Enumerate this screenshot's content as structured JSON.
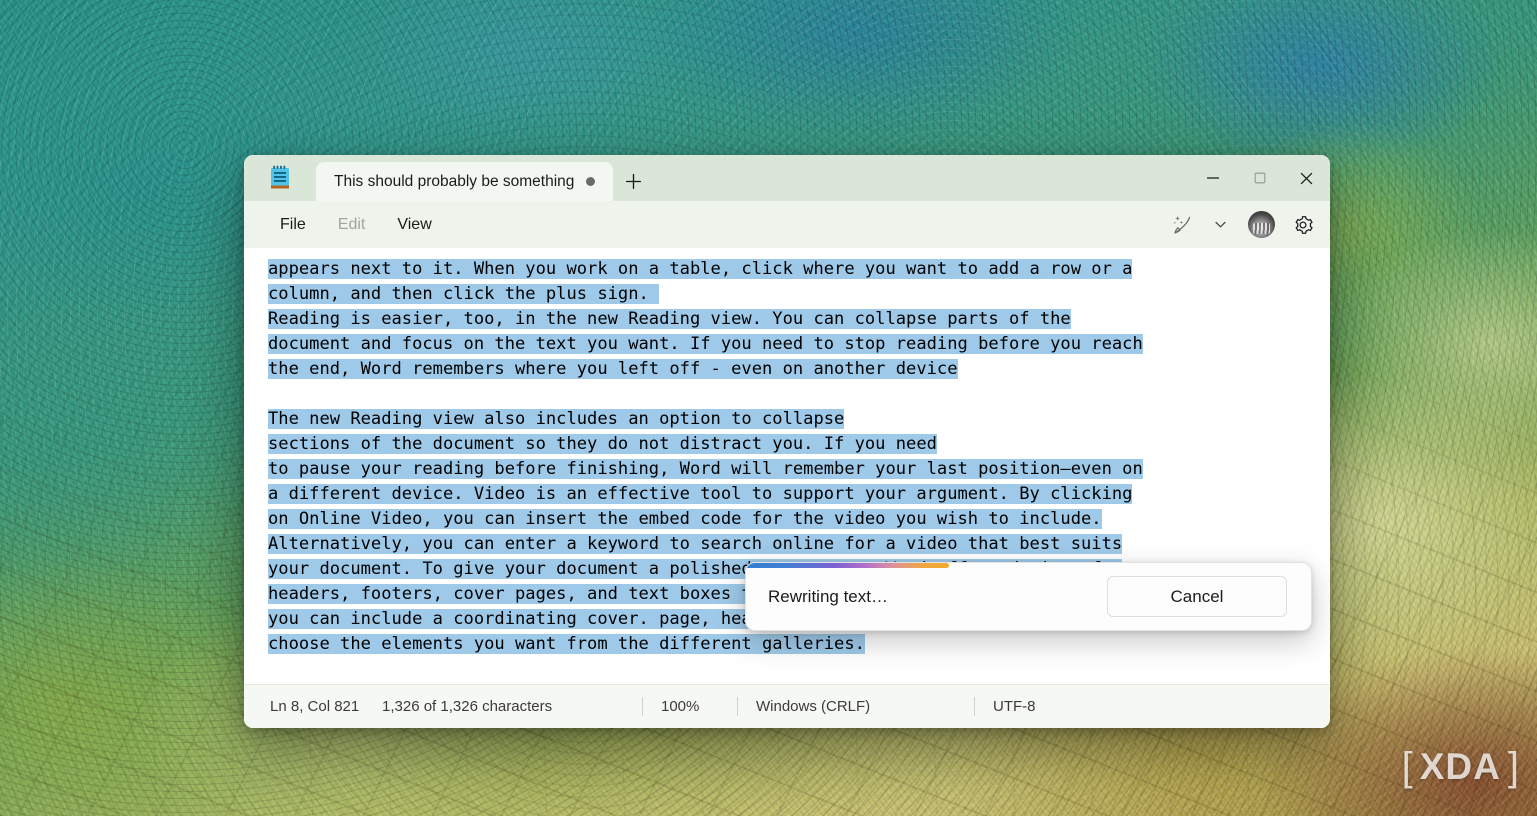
{
  "desktop": {
    "watermark": {
      "left_bracket": "[",
      "text": "XDA",
      "right_bracket": "]"
    }
  },
  "window": {
    "app_icon": "notepad-icon",
    "tab": {
      "title": "This should probably be something",
      "unsaved_dot": "●"
    },
    "new_tab_label": "+",
    "controls": {
      "minimize": "minimize-icon",
      "maximize": "maximize-icon",
      "close": "close-icon"
    }
  },
  "menu": {
    "items": [
      {
        "label": "File",
        "disabled": false
      },
      {
        "label": "Edit",
        "disabled": true
      },
      {
        "label": "View",
        "disabled": false
      }
    ],
    "right_icons": [
      {
        "name": "ai-rewrite-icon"
      },
      {
        "name": "chevron-down-icon"
      },
      {
        "name": "account-avatar"
      },
      {
        "name": "settings-gear-icon"
      }
    ]
  },
  "editor": {
    "lines": [
      {
        "text": "appears next to it. When you work on a table, click where you want to add a row or a",
        "selected": true
      },
      {
        "text": "column, and then click the plus sign. ",
        "selected": true
      },
      {
        "text": "Reading is easier, too, in the new Reading view. You can collapse parts of the",
        "selected": true
      },
      {
        "text": "document and focus on the text you want. If you need to stop reading before you reach",
        "selected": true
      },
      {
        "text": "the end, Word remembers where you left off - even on another device",
        "selected": true
      },
      {
        "text": "",
        "selected": false
      },
      {
        "text": "The new Reading view also includes an option to collapse",
        "selected": true
      },
      {
        "text": "sections of the document so they do not distract you. If you need",
        "selected": true
      },
      {
        "text": "to pause your reading before finishing, Word will remember your last position—even on",
        "selected": true
      },
      {
        "text": "a different device. Video is an effective tool to support your argument. By clicking",
        "selected": true
      },
      {
        "text": "on Online Video, you can insert the embed code for the video you wish to include.",
        "selected": true
      },
      {
        "text": "Alternatively, you can enter a keyword to search online for a video that best suits",
        "selected": true
      },
      {
        "text": "your document. To give your document a polished appearance, Word offers designs for",
        "selected": true
      },
      {
        "text": "headers, footers, cover pages, and text boxes that work well together. For instance,",
        "selected": true
      },
      {
        "text": "you can include a coordinating cover. page, header, and sidebar. Click Insert and then",
        "selected": true
      },
      {
        "text": "choose the elements you want from the different galleries.",
        "selected": true
      }
    ]
  },
  "dialog": {
    "message": "Rewriting text…",
    "cancel_label": "Cancel",
    "progress_percent": 36,
    "progress_gradient": [
      "#2f7ed1",
      "#7b62d4",
      "#b06ecb",
      "#f0a83f"
    ]
  },
  "status_bar": {
    "cursor_position": "Ln 8, Col 821",
    "character_count": "1,326 of 1,326 characters",
    "zoom": "100%",
    "line_ending": "Windows (CRLF)",
    "encoding": "UTF-8"
  },
  "colors": {
    "titlebar": "#d9e6d8",
    "menubar": "#eef4ec",
    "tab_active": "#f3f7f1",
    "selection": "#9ec9e8",
    "statusbar": "#f6f8f4"
  }
}
